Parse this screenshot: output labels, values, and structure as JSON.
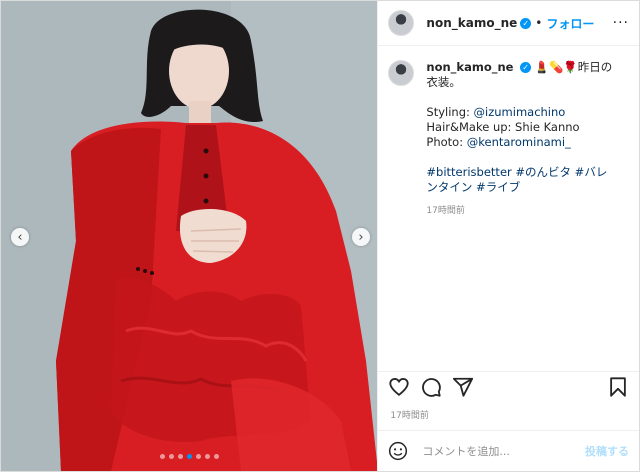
{
  "header": {
    "username": "non_kamo_ne",
    "separator": "•",
    "follow_label": "フォロー",
    "more_label": "···"
  },
  "caption": {
    "username": "non_kamo_ne",
    "emojis": "💄💊🌹",
    "text": "昨日の衣装。",
    "styling_label": "Styling: ",
    "styling_handle": "@izumimachino",
    "hair_makeup": "Hair&Make up: Shie Kanno",
    "photo_label": "Photo: ",
    "photo_handle": "@kentarominami_",
    "hashtags": "#bitterisbetter #のんビタ #バレンタイン #ライブ",
    "time_small": "17時間前"
  },
  "footer": {
    "timestamp": "17時間前"
  },
  "comment": {
    "placeholder": "コメントを追加...",
    "post_label": "投稿する"
  },
  "carousel": {
    "prev_label": "‹",
    "next_label": "›",
    "slide_count": 7,
    "active_index": 3
  },
  "colors": {
    "accent": "#0095f6",
    "link": "#00376b",
    "muted": "#8e8e8e",
    "suit_red": "#d81e22"
  }
}
